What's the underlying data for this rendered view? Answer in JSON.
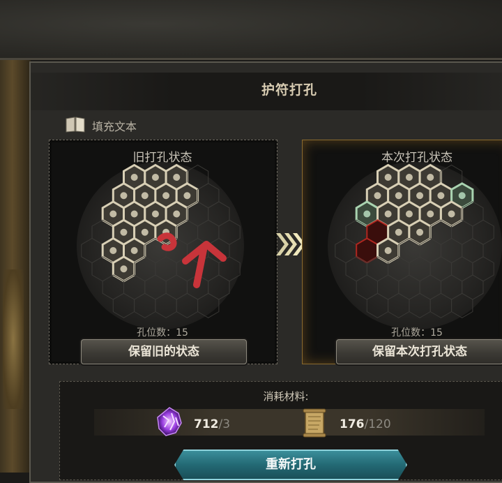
{
  "dialog": {
    "title": "护符打孔",
    "fill_text": "填充文本"
  },
  "old_state": {
    "title": "旧打孔状态",
    "hole_count_label": "孔位数：15",
    "button_label": "保留旧的状态"
  },
  "new_state": {
    "title": "本次打孔状态",
    "hole_count_label": "孔位数：15",
    "button_label": "保留本次打孔状态"
  },
  "materials": {
    "title": "消耗材料:",
    "items": [
      {
        "icon": "purple-crystal-icon",
        "owned": "712",
        "required": "/3"
      },
      {
        "icon": "scroll-icon",
        "owned": "176",
        "required": "/120"
      }
    ]
  },
  "action": {
    "reforge_label": "重新打孔"
  },
  "colors": {
    "accent_teal": "#2f8a97",
    "gold_border": "#8a6a2e",
    "red_socket": "#b0261f"
  }
}
